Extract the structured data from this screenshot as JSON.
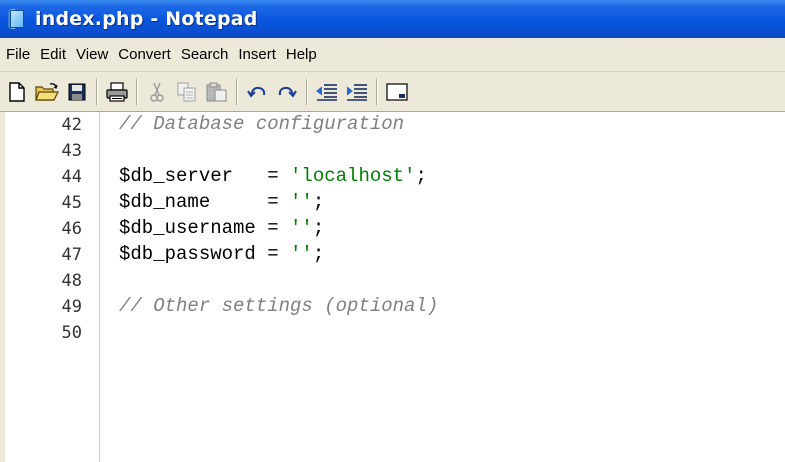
{
  "window": {
    "title": "index.php - Notepad",
    "icon": "notepad-icon"
  },
  "menu": [
    "File",
    "Edit",
    "View",
    "Convert",
    "Search",
    "Insert",
    "Help"
  ],
  "toolbar": {
    "buttons": [
      {
        "name": "new-file-icon"
      },
      {
        "name": "open-folder-icon"
      },
      {
        "name": "save-floppy-icon"
      },
      {
        "name": "print-icon"
      },
      {
        "name": "cut-scissors-icon"
      },
      {
        "name": "copy-icon"
      },
      {
        "name": "paste-icon"
      },
      {
        "name": "undo-icon"
      },
      {
        "name": "redo-icon"
      },
      {
        "name": "outdent-icon"
      },
      {
        "name": "indent-icon"
      },
      {
        "name": "window-icon"
      }
    ]
  },
  "colors": {
    "comment": "#808080",
    "string": "#008000",
    "code": "#000000"
  },
  "editor": {
    "lines": [
      {
        "num": "42",
        "parts": [
          {
            "t": "// Database configuration",
            "c": "cm"
          }
        ]
      },
      {
        "num": "43",
        "parts": []
      },
      {
        "num": "44",
        "parts": [
          {
            "t": "$db_server   = ",
            "c": ""
          },
          {
            "t": "'localhost'",
            "c": "str"
          },
          {
            "t": ";",
            "c": ""
          }
        ]
      },
      {
        "num": "45",
        "parts": [
          {
            "t": "$db_name     = ",
            "c": ""
          },
          {
            "t": "''",
            "c": "str"
          },
          {
            "t": ";",
            "c": ""
          }
        ]
      },
      {
        "num": "46",
        "parts": [
          {
            "t": "$db_username = ",
            "c": ""
          },
          {
            "t": "''",
            "c": "str"
          },
          {
            "t": ";",
            "c": ""
          }
        ]
      },
      {
        "num": "47",
        "parts": [
          {
            "t": "$db_password = ",
            "c": ""
          },
          {
            "t": "''",
            "c": "str"
          },
          {
            "t": ";",
            "c": ""
          }
        ]
      },
      {
        "num": "48",
        "parts": []
      },
      {
        "num": "49",
        "parts": [
          {
            "t": "// Other settings (optional)",
            "c": "cm"
          }
        ]
      },
      {
        "num": "50",
        "parts": []
      }
    ]
  }
}
